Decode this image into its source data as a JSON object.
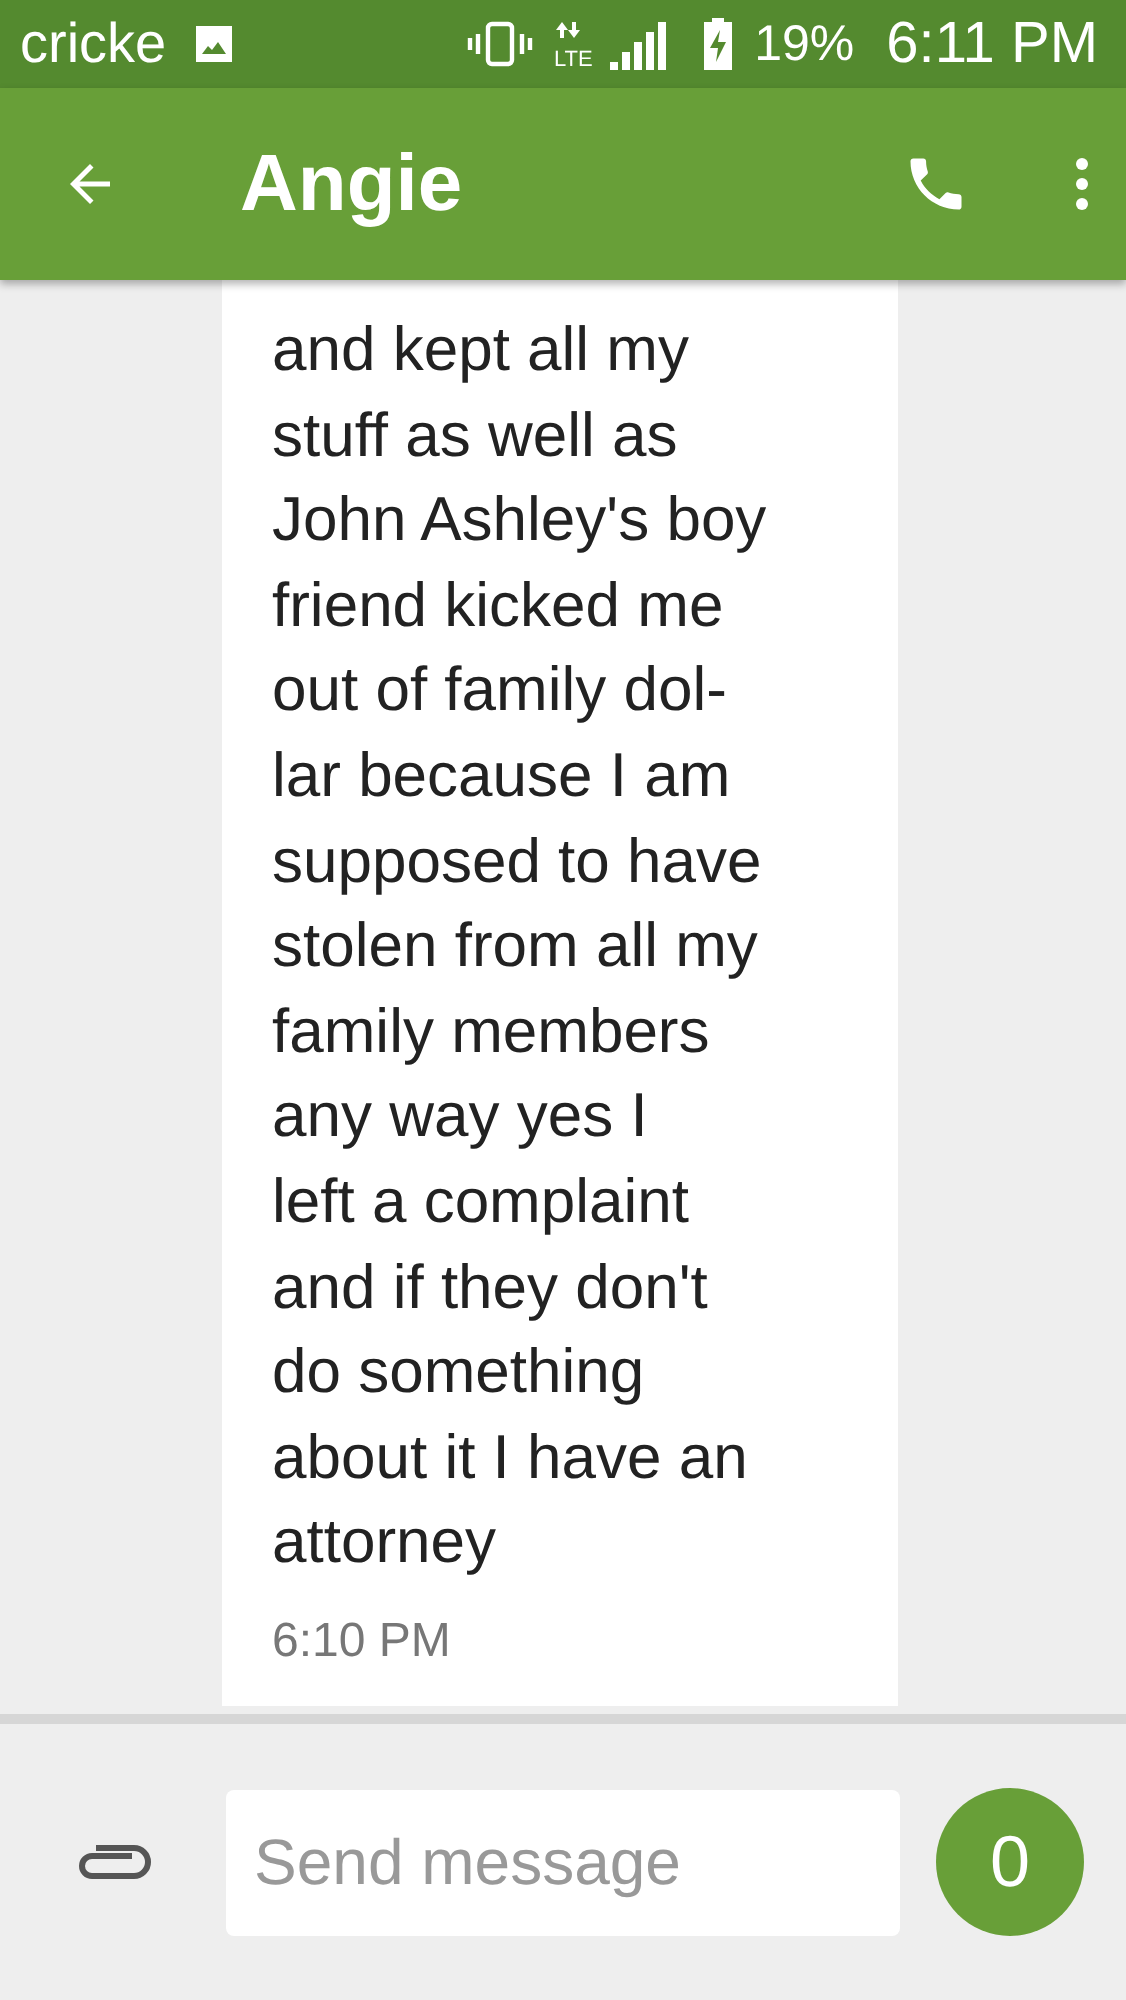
{
  "status_bar": {
    "carrier": "cricke",
    "network": "LTE",
    "battery": "19%",
    "time": "6:11 PM"
  },
  "app_bar": {
    "title": "Angie"
  },
  "message": {
    "lines": [
      "and kept all my",
      "stuff as well as",
      "John Ashley's boy",
      "friend kicked me",
      "out of family dol-",
      "lar because I am",
      "supposed to have",
      "stolen from all my",
      "family members",
      "any way yes I",
      "left a complaint",
      "and if they don't",
      "do something",
      "about it I have an",
      "attorney"
    ],
    "time": "6:10 PM"
  },
  "composer": {
    "placeholder": "Send message",
    "count": "0"
  }
}
